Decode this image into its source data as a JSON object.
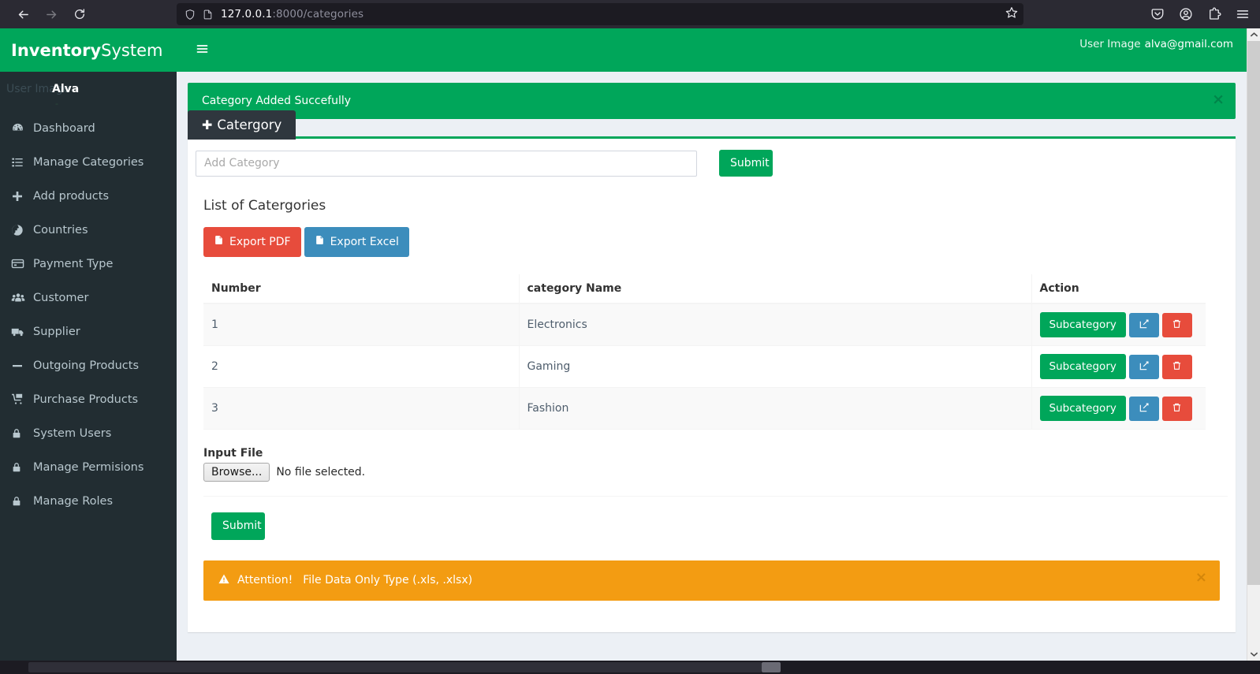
{
  "browser": {
    "back_icon": "back-arrow-icon",
    "forward_icon": "forward-arrow-icon",
    "reload_icon": "reload-icon",
    "url_host": "127.0.0.1",
    "url_rest": ":8000/categories",
    "shield_icon": "shield-icon",
    "page_icon": "page-document-icon",
    "bookmark_icon": "star-icon",
    "pocket_icon": "pocket-icon",
    "account_icon": "account-circle-icon",
    "extensions_icon": "extensions-puzzle-icon",
    "menu_icon": "hamburger-menu-icon"
  },
  "sidebar": {
    "brand_bold": "Inventory",
    "brand_light": " System",
    "user_image_alt": "User Image",
    "user_name": "Alva",
    "user_status": "-",
    "items": [
      {
        "label": "Dashboard",
        "icon": "dashboard-icon"
      },
      {
        "label": "Manage Categories",
        "icon": "list-icon"
      },
      {
        "label": "Add products",
        "icon": "plus-icon"
      },
      {
        "label": "Countries",
        "icon": "globe-icon"
      },
      {
        "label": "Payment Type",
        "icon": "credit-card-icon"
      },
      {
        "label": "Customer",
        "icon": "users-icon"
      },
      {
        "label": "Supplier",
        "icon": "truck-icon"
      },
      {
        "label": "Outgoing Products",
        "icon": "minus-icon"
      },
      {
        "label": "Purchase Products",
        "icon": "cart-icon"
      },
      {
        "label": "System Users",
        "icon": "lock-icon"
      },
      {
        "label": "Manage Permisions",
        "icon": "lock-icon"
      },
      {
        "label": "Manage Roles",
        "icon": "lock-icon"
      }
    ]
  },
  "topbar": {
    "toggle_icon": "hamburger-menu-icon",
    "user_image_alt": "User Image",
    "user_email": "alva@gmail.com"
  },
  "alerts": {
    "success_message": "Category Added Succefully",
    "success_close": "×",
    "warning_title": "Attention!",
    "warning_message": "File Data Only Type (.xls, .xlsx)",
    "warning_close": "×",
    "warning_icon": "warning-triangle-icon"
  },
  "panel": {
    "tab_label": "Catergory",
    "tab_plus": "✚",
    "add_placeholder": "Add Category",
    "add_value": "",
    "submit_label": "Submit",
    "list_title": "List of Catergories",
    "export_pdf_label": "Export PDF",
    "export_excel_label": "Export Excel",
    "export_pdf_icon": "file-pdf-icon",
    "export_excel_icon": "file-excel-icon"
  },
  "table": {
    "columns": [
      "Number",
      "category Name",
      "Action"
    ],
    "rows": [
      {
        "number": "1",
        "name": "Electronics",
        "sub_label": "Subcategory",
        "edit_icon": "edit-pencil-icon",
        "delete_icon": "trash-icon"
      },
      {
        "number": "2",
        "name": "Gaming",
        "sub_label": "Subcategory",
        "edit_icon": "edit-pencil-icon",
        "delete_icon": "trash-icon"
      },
      {
        "number": "3",
        "name": "Fashion",
        "sub_label": "Subcategory",
        "edit_icon": "edit-pencil-icon",
        "delete_icon": "trash-icon"
      }
    ]
  },
  "upload": {
    "label": "Input File",
    "browse_label": "Browse...",
    "file_status": "No file selected.",
    "submit_label": "Submit"
  },
  "colors": {
    "brand_green": "#00a65a",
    "sidebar_dark": "#222d32",
    "tab_dark": "#2f373e",
    "danger_red": "#e74c3c",
    "info_blue": "#3c8dbc",
    "warning_orange": "#f39c12",
    "page_bg": "#ecf0f5"
  }
}
